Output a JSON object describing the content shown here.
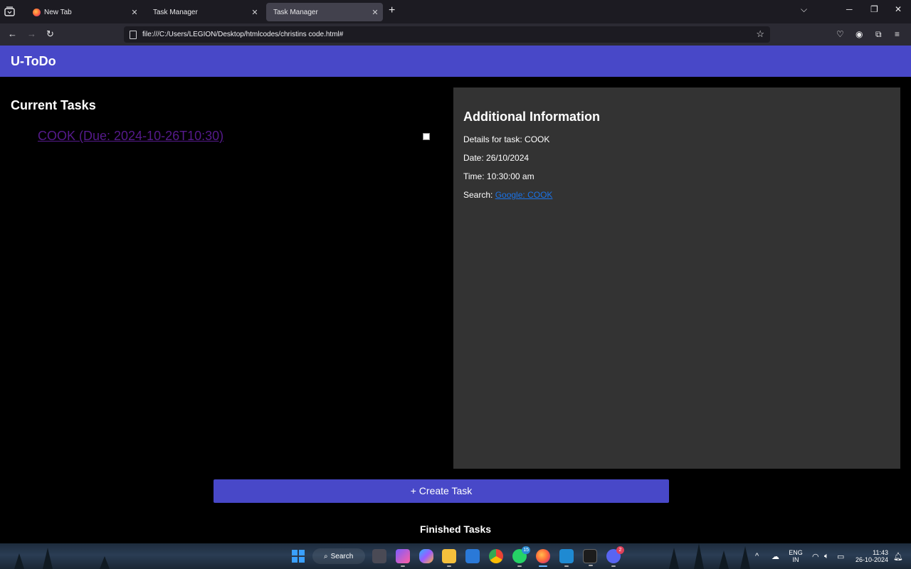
{
  "browser": {
    "tabs": [
      {
        "label": "New Tab",
        "active": false
      },
      {
        "label": "Task Manager",
        "active": false
      },
      {
        "label": "Task Manager",
        "active": true
      }
    ],
    "url": "file:///C:/Users/LEGION/Desktop/htmlcodes/christins code.html#"
  },
  "app": {
    "title": "U-ToDo",
    "current_tasks_heading": "Current Tasks",
    "tasks": [
      {
        "label": "COOK (Due: 2024-10-26T10:30)",
        "checked": false
      }
    ],
    "info": {
      "heading": "Additional Information",
      "details": "Details for task: COOK",
      "date": "Date: 26/10/2024",
      "time": "Time: 10:30:00 am",
      "search_label": "Search:",
      "search_link": "Google: COOK"
    },
    "create_button": "+ Create Task",
    "finished_heading": "Finished Tasks"
  },
  "taskbar": {
    "search_label": "Search",
    "whatsapp_badge": "15",
    "discord_badge": "2",
    "lang_top": "ENG",
    "lang_bottom": "IN",
    "time": "11:43",
    "date": "26-10-2024"
  },
  "colors": {
    "accent": "#4848c8",
    "info_panel": "#333333",
    "visited_link": "#551a8b",
    "link": "#1a73e8"
  }
}
